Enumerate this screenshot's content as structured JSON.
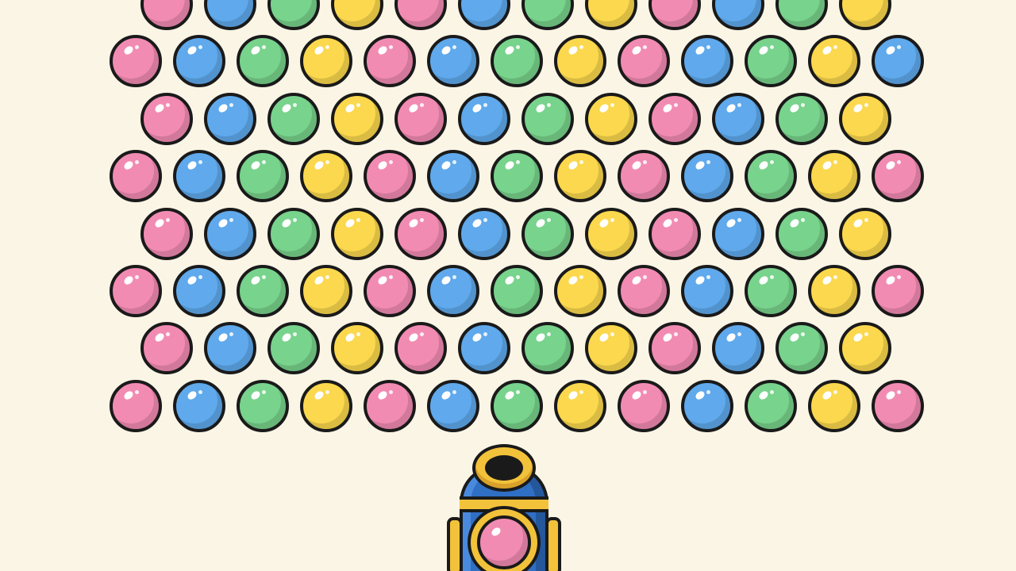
{
  "palette": {
    "background": "#fbf5e6",
    "pink": "#f28bb2",
    "blue": "#5fa9ec",
    "green": "#78d38c",
    "yellow": "#fbd84d",
    "outline": "#1a1a1a",
    "cannon_blue": "#2f6fc4",
    "cannon_gold": "#f2c23a"
  },
  "board": {
    "rows": [
      [
        "pink",
        "blue",
        "green",
        "yellow",
        "pink",
        "blue",
        "green",
        "yellow",
        "pink",
        "blue",
        "green",
        "yellow"
      ],
      [
        "pink",
        "blue",
        "green",
        "yellow",
        "pink",
        "blue",
        "green",
        "yellow",
        "pink",
        "blue",
        "green",
        "yellow",
        "blue"
      ],
      [
        "pink",
        "blue",
        "green",
        "yellow",
        "pink",
        "blue",
        "green",
        "yellow",
        "pink",
        "blue",
        "green",
        "yellow"
      ],
      [
        "pink",
        "blue",
        "green",
        "yellow",
        "pink",
        "blue",
        "green",
        "yellow",
        "pink",
        "blue",
        "green",
        "yellow",
        "pink"
      ],
      [
        "pink",
        "blue",
        "green",
        "yellow",
        "pink",
        "blue",
        "green",
        "yellow",
        "pink",
        "blue",
        "green",
        "yellow"
      ],
      [
        "pink",
        "blue",
        "green",
        "yellow",
        "pink",
        "blue",
        "green",
        "yellow",
        "pink",
        "blue",
        "green",
        "yellow",
        "pink"
      ],
      [
        "pink",
        "blue",
        "green",
        "yellow",
        "pink",
        "blue",
        "green",
        "yellow",
        "pink",
        "blue",
        "green",
        "yellow"
      ],
      [
        "pink",
        "blue",
        "green",
        "yellow",
        "pink",
        "blue",
        "green",
        "yellow",
        "pink",
        "blue",
        "green",
        "yellow",
        "pink"
      ]
    ]
  },
  "cannon": {
    "loaded_bubble": "pink"
  }
}
